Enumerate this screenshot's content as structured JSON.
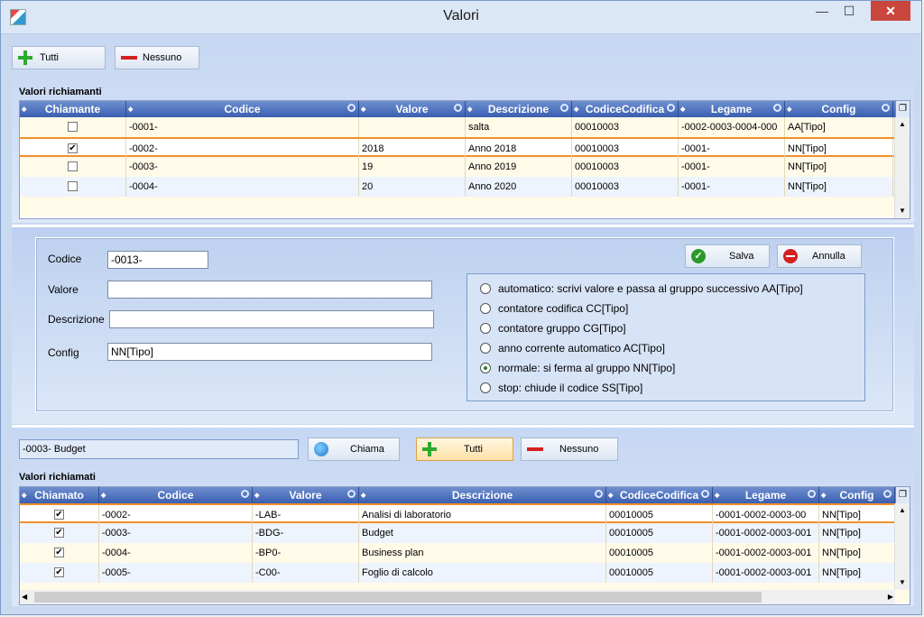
{
  "window": {
    "title": "Valori"
  },
  "top_toolbar": {
    "all_label": "Tutti",
    "none_label": "Nessuno"
  },
  "calling": {
    "section_label": "Valori richiamanti",
    "columns": [
      "Chiamante",
      "Codice",
      "Valore",
      "Descrizione",
      "CodiceCodifica",
      "Legame",
      "Config"
    ],
    "rows": [
      {
        "checked": false,
        "codice": "-0001-",
        "valore": "",
        "descrizione": "salta",
        "codifica": "00010003",
        "legame": "-0002-0003-0004-000",
        "config": "AA[Tipo]"
      },
      {
        "checked": true,
        "codice": "-0002-",
        "valore": "2018",
        "descrizione": "Anno 2018",
        "codifica": "00010003",
        "legame": "-0001-",
        "config": "NN[Tipo]"
      },
      {
        "checked": false,
        "codice": "-0003-",
        "valore": "19",
        "descrizione": "Anno 2019",
        "codifica": "00010003",
        "legame": "-0001-",
        "config": "NN[Tipo]"
      },
      {
        "checked": false,
        "codice": "-0004-",
        "valore": "20",
        "descrizione": "Anno 2020",
        "codifica": "00010003",
        "legame": "-0001-",
        "config": "NN[Tipo]"
      }
    ]
  },
  "editor": {
    "codice_label": "Codice",
    "codice_value": "-0013-",
    "valore_label": "Valore",
    "valore_value": "",
    "descrizione_label": "Descrizione",
    "descrizione_value": "",
    "config_label": "Config",
    "config_value": "NN[Tipo]",
    "save_label": "Salva",
    "cancel_label": "Annulla",
    "options": [
      {
        "label": "automatico: scrivi valore e passa al gruppo successivo AA[Tipo]",
        "selected": false
      },
      {
        "label": "contatore codifica CC[Tipo]",
        "selected": false
      },
      {
        "label": "contatore gruppo CG[Tipo]",
        "selected": false
      },
      {
        "label": "anno corrente automatico AC[Tipo]",
        "selected": false
      },
      {
        "label": "normale: si ferma al gruppo NN[Tipo]",
        "selected": true
      },
      {
        "label": "stop: chiude il codice SS[Tipo]",
        "selected": false
      }
    ]
  },
  "bottom_toolbar": {
    "current": "-0003- Budget",
    "call_label": "Chiama",
    "all_label": "Tutti",
    "none_label": "Nessuno"
  },
  "called": {
    "section_label": "Valori richiamati",
    "columns": [
      "Chiamato",
      "Codice",
      "Valore",
      "Descrizione",
      "CodiceCodifica",
      "Legame",
      "Config"
    ],
    "rows": [
      {
        "checked": true,
        "codice": "-0002-",
        "valore": "-LAB-",
        "descrizione": "Analisi di laboratorio",
        "codifica": "00010005",
        "legame": "-0001-0002-0003-00",
        "config": "NN[Tipo]"
      },
      {
        "checked": true,
        "codice": "-0003-",
        "valore": "-BDG-",
        "descrizione": "Budget",
        "codifica": "00010005",
        "legame": "-0001-0002-0003-001",
        "config": "NN[Tipo]"
      },
      {
        "checked": true,
        "codice": "-0004-",
        "valore": "-BP0-",
        "descrizione": "Business plan",
        "codifica": "00010005",
        "legame": "-0001-0002-0003-001",
        "config": "NN[Tipo]"
      },
      {
        "checked": true,
        "codice": "-0005-",
        "valore": "-C00-",
        "descrizione": "Foglio di calcolo",
        "codifica": "00010005",
        "legame": "-0001-0002-0003-001",
        "config": "NN[Tipo]"
      }
    ]
  }
}
